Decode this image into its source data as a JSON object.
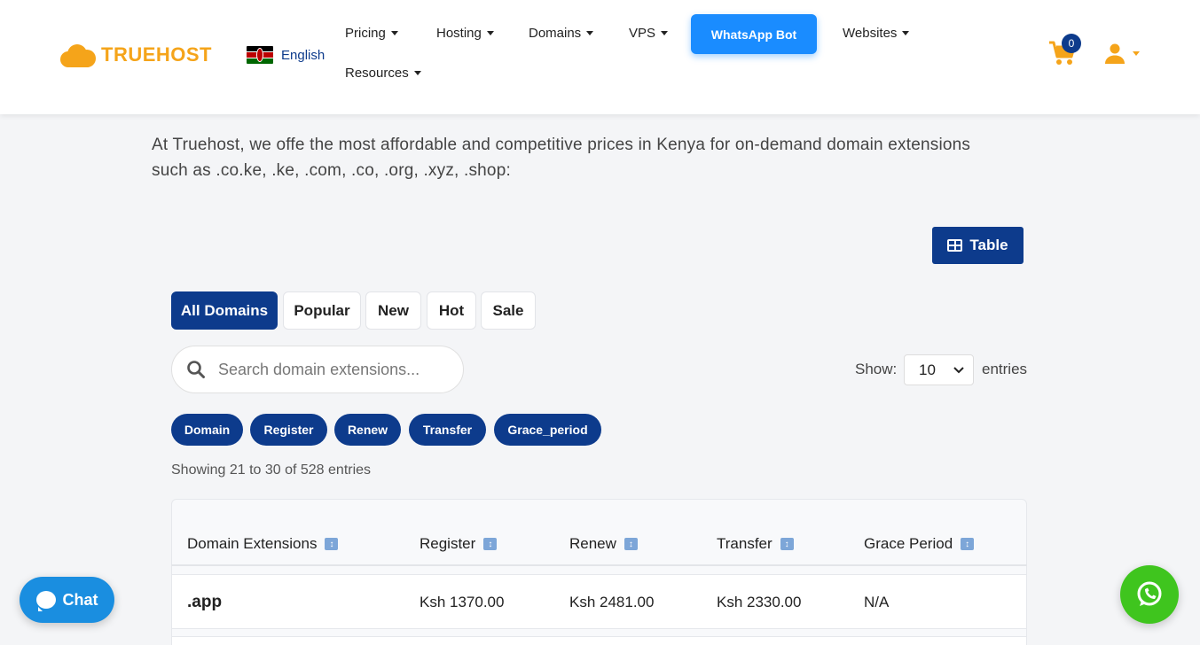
{
  "brand": {
    "name": "TRUEHOST",
    "color": "#f5a41a"
  },
  "language": {
    "label": "English",
    "flag_icon": "kenya-flag-icon"
  },
  "nav": {
    "pricing": "Pricing",
    "hosting": "Hosting",
    "domains": "Domains",
    "vps": "VPS",
    "whatsapp_bot": "WhatsApp Bot",
    "websites": "Websites",
    "resources": "Resources"
  },
  "cart": {
    "count": "0",
    "icon": "cart-icon"
  },
  "user": {
    "icon": "user-icon"
  },
  "intro": "At Truehost, we offe the most affordable and competitive prices in Kenya for on-demand domain extensions such as .co.ke, .ke, .com, .co, .org, .xyz, .shop:",
  "view_toggle": {
    "label": "Table",
    "icon": "table-icon"
  },
  "filter_tabs": [
    "All Domains",
    "Popular",
    "New",
    "Hot",
    "Sale"
  ],
  "search": {
    "placeholder": "Search domain extensions..."
  },
  "page_size": {
    "show_label": "Show:",
    "value": "10",
    "entries_label": "entries"
  },
  "column_pills": [
    "Domain",
    "Register",
    "Renew",
    "Transfer",
    "Grace_period"
  ],
  "showing_text": "Showing 21 to 30 of 528 entries",
  "table": {
    "headers": [
      "Domain Extensions",
      "Register",
      "Renew",
      "Transfer",
      "Grace Period"
    ],
    "rows": [
      {
        "ext": ".app",
        "register": "Ksh 1370.00",
        "renew": "Ksh 2481.00",
        "transfer": "Ksh 2330.00",
        "grace": "N/A"
      }
    ]
  },
  "chat": {
    "label": "Chat"
  },
  "colors": {
    "primary": "#0d3b8c",
    "accent": "#1a8cff",
    "whatsapp": "#3fc51e"
  }
}
